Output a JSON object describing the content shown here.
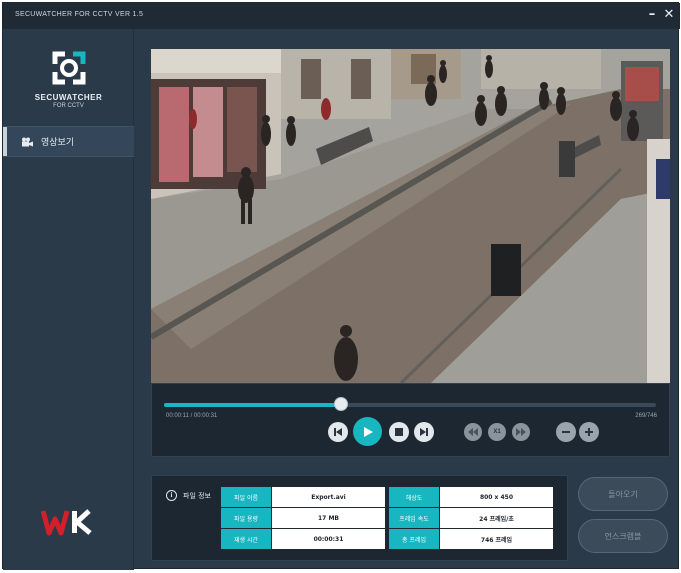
{
  "window": {
    "title": "SECUWATCHER FOR CCTV VER 1.5",
    "minimize_icon": "minus-icon",
    "close_icon": "close-icon"
  },
  "sidebar": {
    "logo_text": "SECUWATCHER",
    "logo_sub": "FOR CCTV",
    "menu_item": "영상보기",
    "brand_logo": "WK"
  },
  "player": {
    "current_time": "00:00:11 / 00:00:31",
    "frame_counter": "269/746",
    "progress": 0.36,
    "speed_label": "X1",
    "accent": "#17b6c0"
  },
  "file_info": {
    "heading": "파일 정보",
    "rows": [
      {
        "l1": "파일 이름",
        "v1": "Export.avi",
        "l2": "해상도",
        "v2": "800 x 450"
      },
      {
        "l1": "파일 용량",
        "v1": "17 MB",
        "l2": "프레임 속도",
        "v2": "24 프레임/초"
      },
      {
        "l1": "재생 시간",
        "v1": "00:00:31",
        "l2": "총 프레임",
        "v2": "746 프레임"
      }
    ]
  },
  "actions": {
    "back_label": "돌아오기",
    "uninstall_label": "언스크램블"
  }
}
